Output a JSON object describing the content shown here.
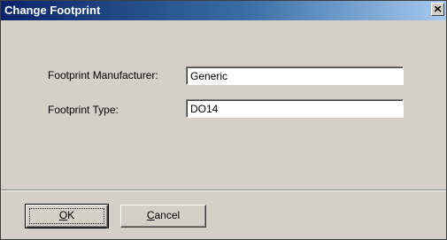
{
  "window": {
    "title": "Change Footprint",
    "close_glyph": "×"
  },
  "form": {
    "manufacturer_label": "Footprint Manufacturer:",
    "manufacturer_value": "Generic",
    "type_label": "Footprint Type:",
    "type_value": "DO14"
  },
  "buttons": {
    "ok_mnemonic": "O",
    "ok_rest": "K",
    "cancel_mnemonic": "C",
    "cancel_rest": "ancel"
  },
  "colors": {
    "face": "#d4d0c8",
    "title_start": "#0a246a",
    "title_end": "#a6caf0"
  }
}
